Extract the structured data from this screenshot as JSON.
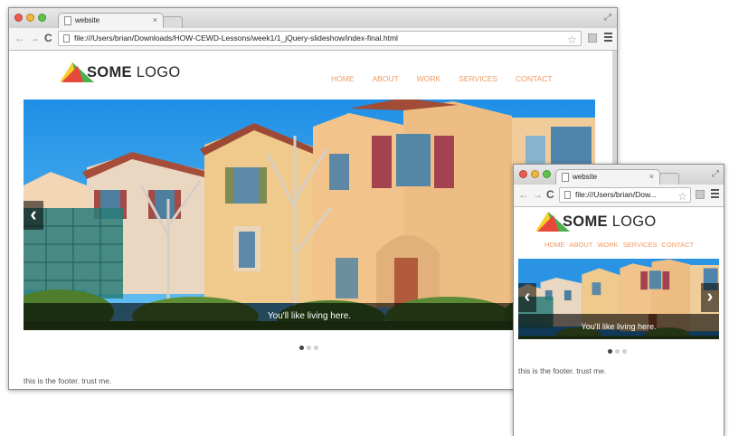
{
  "desktop": {
    "tab_title": "website",
    "tab_close": "×",
    "url": "file:///Users/brian/Downloads/HOW-CEWD-Lessons/week1/1_jQuery-slideshow/index-final.html",
    "logo": {
      "bold": "SOME",
      "light": "LOGO"
    },
    "nav": [
      "HOME",
      "ABOUT",
      "WORK",
      "SERVICES",
      "CONTACT"
    ],
    "slider": {
      "caption": "You'll like living here.",
      "prev": "‹",
      "next": "›",
      "slide_count": 3,
      "active_index": 0
    },
    "footer": "this is the footer. trust me."
  },
  "mobile": {
    "tab_title": "website",
    "tab_close": "×",
    "url": "file:///Users/brian/Dow...",
    "logo": {
      "bold": "SOME",
      "light": "LOGO"
    },
    "nav": [
      "HOME",
      "ABOUT",
      "WORK",
      "SERVICES",
      "CONTACT"
    ],
    "slider": {
      "caption": "You'll like living here.",
      "prev": "‹",
      "next": "›",
      "slide_count": 3,
      "active_index": 0
    },
    "footer": "this is the footer. trust me."
  },
  "icons": {
    "back": "←",
    "forward": "→",
    "reload": "C",
    "bookmark": "☆",
    "fullscreen": "⤢"
  },
  "colors": {
    "nav_link": "#f29a61",
    "logo_red": "#e8483b",
    "logo_yellow": "#f5cf2a",
    "logo_green": "#4caf50",
    "caption_bg": "#000000"
  }
}
